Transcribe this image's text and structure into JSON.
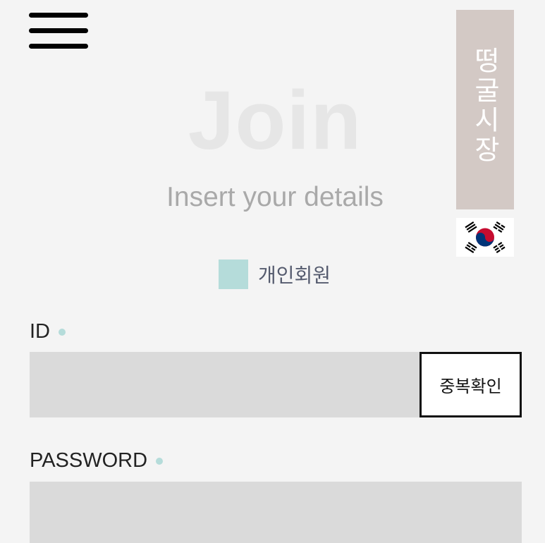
{
  "header": {
    "menu_icon": "hamburger-menu-icon",
    "brand_text": "떵굴시장",
    "brand_color": "#d3c9c5",
    "language_flag": "south-korea-flag-icon"
  },
  "hero": {
    "title": "Join",
    "subtitle": "Insert your details"
  },
  "member_type": {
    "label": "개인회원",
    "accent_color": "#b5dcda"
  },
  "form": {
    "id": {
      "label": "ID",
      "value": "",
      "check_button_label": "중복확인"
    },
    "password": {
      "label": "PASSWORD",
      "value": ""
    }
  }
}
